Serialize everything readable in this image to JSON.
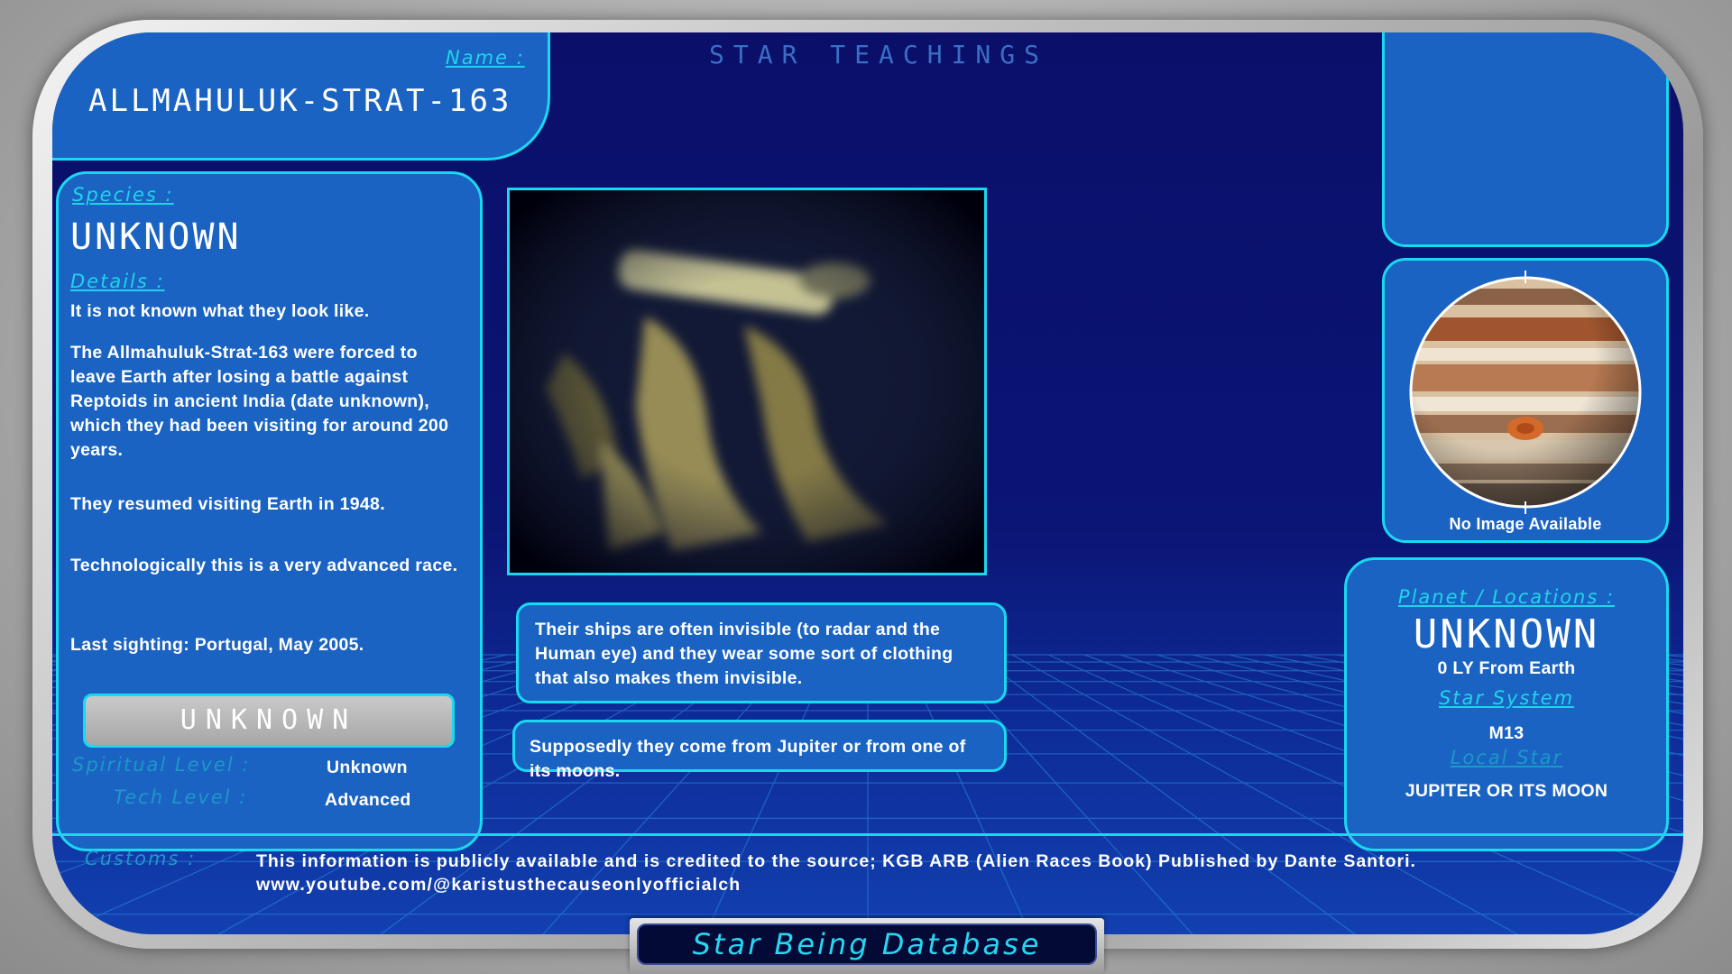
{
  "header": {
    "title": "STAR TEACHINGS",
    "name_label": "Name :",
    "name_value": "ALLMAHULUK-STRAT-163"
  },
  "species_panel": {
    "species_label": "Species :",
    "species_value": "UNKNOWN",
    "details_label": "Details :",
    "details": [
      "It is not known what they look like.",
      "The Allmahuluk-Strat-163 were forced to leave Earth after losing a battle against Reptoids in ancient India (date unknown), which they had been visiting for around 200 years.",
      "They resumed visiting Earth in 1948.",
      "Technologically this is a very advanced race.",
      "Last sighting: Portugal, May 2005."
    ],
    "status_button": "UNKNOWN",
    "spiritual_label": "Spiritual Level :",
    "spiritual_value": "Unknown",
    "tech_label": "Tech Level :",
    "tech_value": "Advanced"
  },
  "info_boxes": {
    "ships": "Their ships are often invisible (to radar and the Human eye) and they wear some sort of clothing that also makes them invisible.",
    "origin": "Supposedly they come from Jupiter or from one of its moons."
  },
  "planet_panel": {
    "image_caption": "No Image Available",
    "locations_label": "Planet / Locations :",
    "location_value": "UNKNOWN",
    "distance": "0 LY From Earth",
    "star_system_label": "Star System",
    "star_system_value": "M13",
    "local_star_label": "Local Star",
    "local_star_value": "JUPITER OR ITS MOON"
  },
  "footer": {
    "customs_label": "Customs :",
    "credit_line": "This information is publicly available and is credited to the source;  KGB ARB (Alien Races Book) Published by Dante Santori.",
    "url": "www.youtube.com/@karistusthecauseonlyofficialch",
    "database_title": "Star Being Database"
  },
  "colors": {
    "accent_cyan": "#19d8f0",
    "panel_blue": "#1a63c2",
    "screen_navy": "#0a0f6a"
  }
}
